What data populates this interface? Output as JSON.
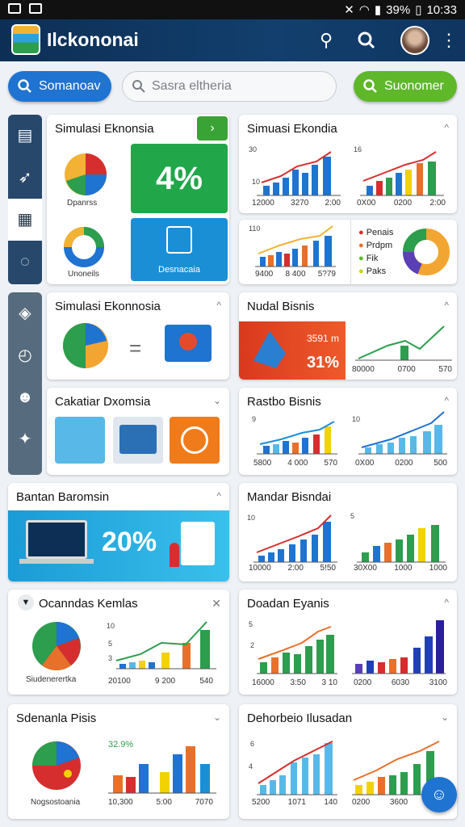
{
  "status": {
    "battery": "39%",
    "time": "10:33"
  },
  "app": {
    "title": "Ilckononai"
  },
  "actions": {
    "left_label": "Somanoav",
    "search_placeholder": "Sasra eltheria",
    "right_label": "Suonomer"
  },
  "cards": {
    "c1": {
      "title": "Simulasi Eknonsia",
      "pie1_label": "Dpanrss",
      "pie2_label": "Unoneils",
      "big_value": "4%",
      "tile_label": "Desnacaia"
    },
    "c2": {
      "title": "Simuasi Ekondia",
      "y1": [
        "30",
        "10",
        "6",
        "0"
      ],
      "x1": [
        "12000",
        "3270",
        "2:00"
      ],
      "y2": [
        "16",
        "10",
        "6"
      ],
      "x2": [
        "0X00",
        "0200",
        "2:00"
      ]
    },
    "c3": {
      "y1": [
        "110",
        "10",
        "10",
        "10"
      ],
      "x1": [
        "9400",
        "8 400",
        "5?79"
      ],
      "legend": [
        "Penais",
        "Prdpm",
        "Fik",
        "Paks"
      ]
    },
    "c4": {
      "title": "Simulasi Ekonnosia"
    },
    "c5": {
      "title": "Nudal Bisnis",
      "banner_value": "3591 m",
      "banner_percent": "31%",
      "x": [
        "80000",
        "0700",
        "570"
      ]
    },
    "c6": {
      "title": "Cakatiar Dxomsia"
    },
    "c7": {
      "title": "Rastbo Bisnis",
      "y1": [
        "9",
        "6",
        "0"
      ],
      "x1": [
        "5800",
        "4 000",
        "570"
      ],
      "y2": [
        "10",
        "6"
      ],
      "x2": [
        "0X00",
        "0200",
        "500"
      ]
    },
    "c8": {
      "title": "Bantan Baromsin",
      "percent": "20%"
    },
    "c9": {
      "title": "Mandar Bisndai",
      "y1": [
        "10",
        "8",
        "0"
      ],
      "x1": [
        "10000",
        "2:00",
        "5!50"
      ],
      "y2": [
        "5",
        "3",
        "0"
      ],
      "x2": [
        "30X00",
        "1000",
        "1000"
      ]
    },
    "c10": {
      "title": "Ocanndas Kemlas",
      "pie_label": "Siudenerertka",
      "y": [
        "10",
        "5",
        "3",
        "0"
      ],
      "x": [
        "20100",
        "9 200",
        "540"
      ]
    },
    "c11": {
      "title": "Doadan Eyanis",
      "y": [
        "5",
        "2",
        "0"
      ],
      "x1": [
        "16000",
        "3:50",
        "3 10"
      ],
      "x2": [
        "0200",
        "6030",
        "3100"
      ]
    },
    "c12": {
      "title": "Sdenanla Pisis",
      "pie_label": "Nogsostoania",
      "percent": "32.9%",
      "x": [
        "10,300",
        "5:00",
        "7070"
      ]
    },
    "c13": {
      "title": "Dehorbeio Ilusadan",
      "y": [
        "6",
        "4",
        "4"
      ],
      "x1": [
        "5200",
        "1071",
        "140"
      ],
      "x2": [
        "0200",
        "3600",
        "8300"
      ]
    }
  },
  "colors": {
    "blue": "#1f73d1",
    "green": "#5eb82a",
    "navy": "#123f6e"
  }
}
